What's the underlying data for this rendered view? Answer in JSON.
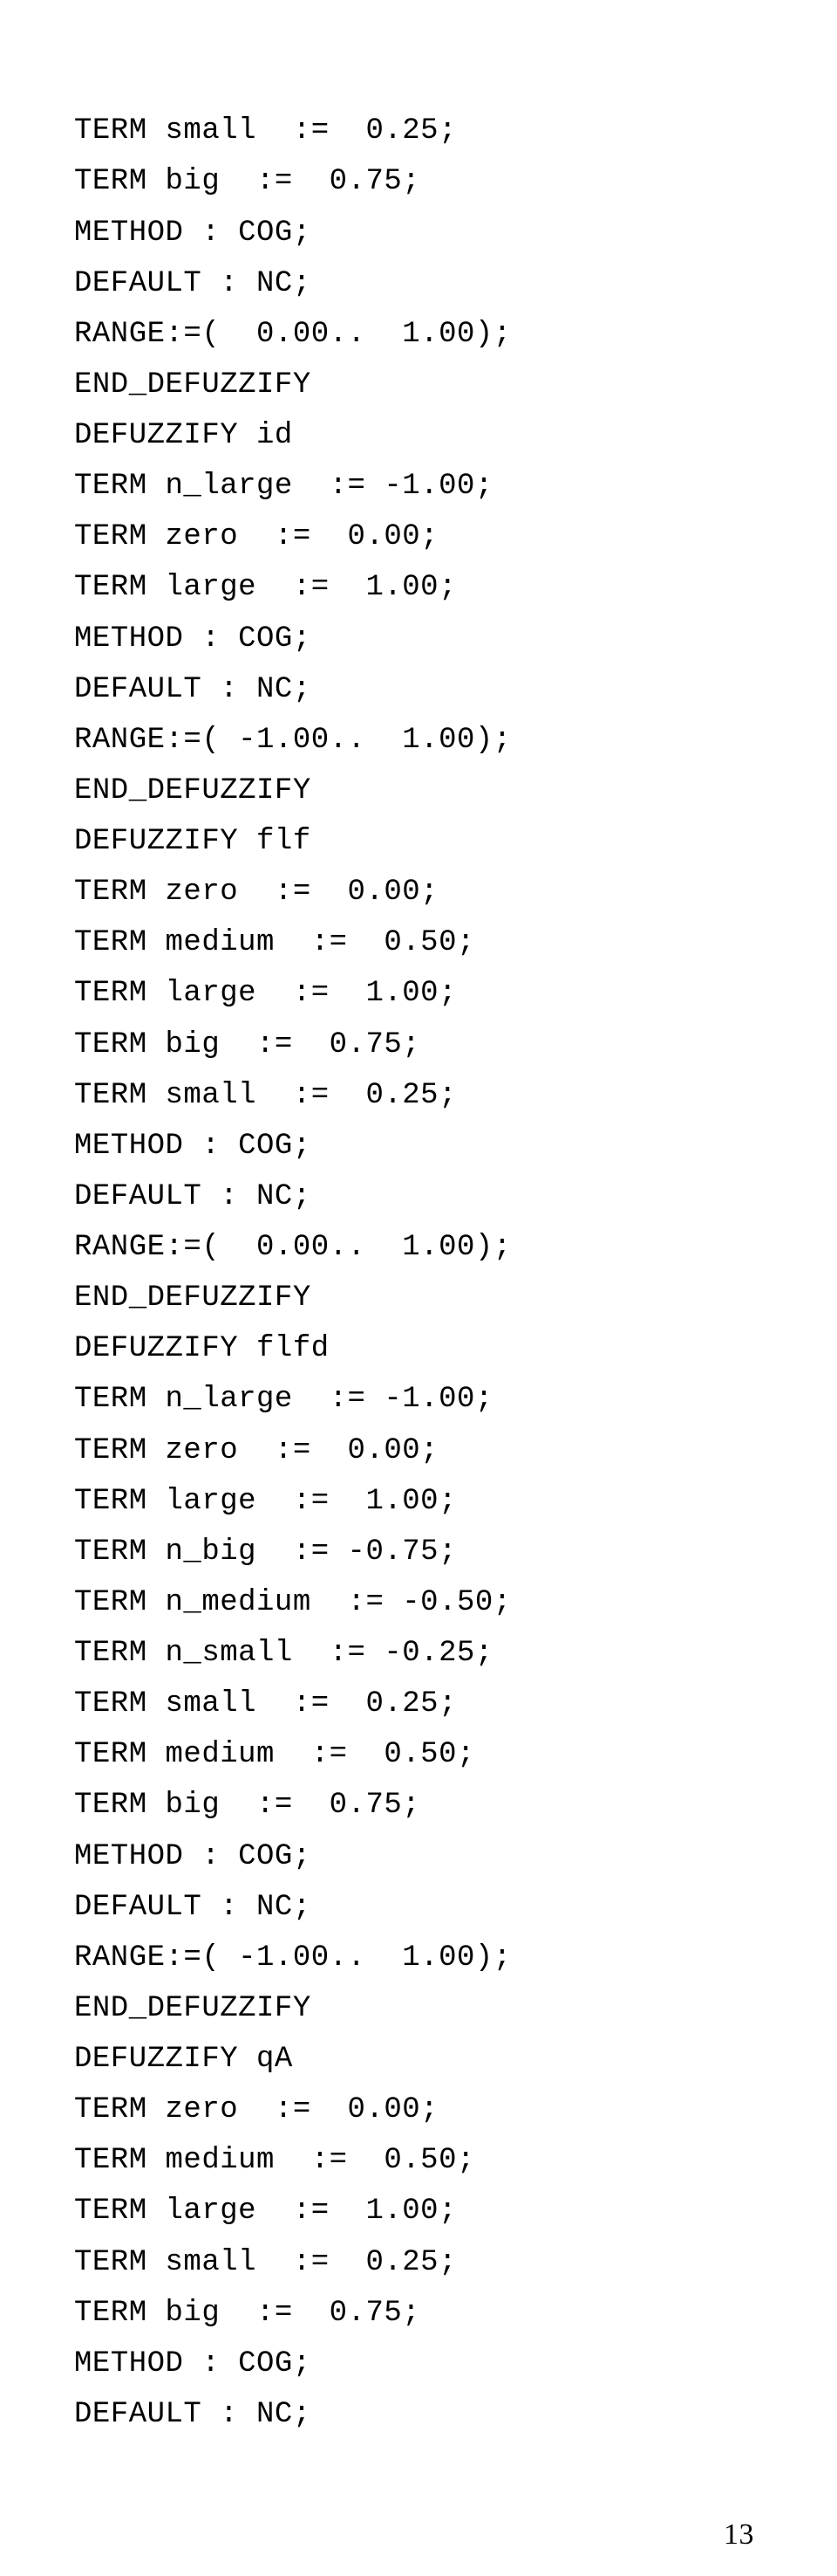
{
  "lines": [
    "TERM small  :=  0.25;",
    "TERM big  :=  0.75;",
    "METHOD : COG;",
    "DEFAULT : NC;",
    "RANGE:=(  0.00..  1.00);",
    "END_DEFUZZIFY",
    "DEFUZZIFY id",
    "TERM n_large  := -1.00;",
    "TERM zero  :=  0.00;",
    "TERM large  :=  1.00;",
    "METHOD : COG;",
    "DEFAULT : NC;",
    "RANGE:=( -1.00..  1.00);",
    "END_DEFUZZIFY",
    "DEFUZZIFY flf",
    "TERM zero  :=  0.00;",
    "TERM medium  :=  0.50;",
    "TERM large  :=  1.00;",
    "TERM big  :=  0.75;",
    "TERM small  :=  0.25;",
    "METHOD : COG;",
    "DEFAULT : NC;",
    "RANGE:=(  0.00..  1.00);",
    "END_DEFUZZIFY",
    "DEFUZZIFY flfd",
    "TERM n_large  := -1.00;",
    "TERM zero  :=  0.00;",
    "TERM large  :=  1.00;",
    "TERM n_big  := -0.75;",
    "TERM n_medium  := -0.50;",
    "TERM n_small  := -0.25;",
    "TERM small  :=  0.25;",
    "TERM medium  :=  0.50;",
    "TERM big  :=  0.75;",
    "METHOD : COG;",
    "DEFAULT : NC;",
    "RANGE:=( -1.00..  1.00);",
    "END_DEFUZZIFY",
    "DEFUZZIFY qA",
    "TERM zero  :=  0.00;",
    "TERM medium  :=  0.50;",
    "TERM large  :=  1.00;",
    "TERM small  :=  0.25;",
    "TERM big  :=  0.75;",
    "METHOD : COG;",
    "DEFAULT : NC;"
  ],
  "page_number": "13"
}
